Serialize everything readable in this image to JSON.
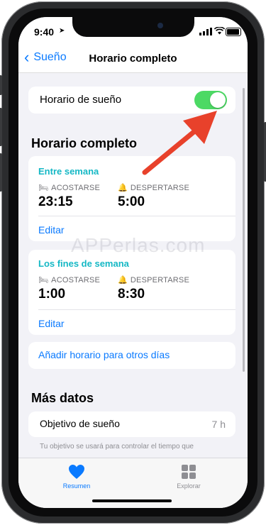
{
  "status": {
    "time": "9:40",
    "location_glyph": "➤"
  },
  "nav": {
    "back_label": "Sueño",
    "title": "Horario completo"
  },
  "toggle_row": {
    "label": "Horario de sueño",
    "enabled": true
  },
  "section_title": "Horario completo",
  "weekdays": {
    "title": "Entre semana",
    "bed_label": "ACOSTARSE",
    "wake_label": "DESPERTARSE",
    "bed_time": "23:15",
    "wake_time": "5:00",
    "edit": "Editar"
  },
  "weekend": {
    "title": "Los fines de semana",
    "bed_label": "ACOSTARSE",
    "wake_label": "DESPERTARSE",
    "bed_time": "1:00",
    "wake_time": "8:30",
    "edit": "Editar"
  },
  "add_other_days": "Añadir horario para otros días",
  "more_data": {
    "title": "Más datos",
    "goal_label": "Objetivo de sueño",
    "goal_value": "7 h",
    "footnote": "Tu objetivo se usará para controlar el tiempo que"
  },
  "tabs": [
    {
      "label": "Resumen",
      "icon": "heart-icon",
      "active": true
    },
    {
      "label": "Explorar",
      "icon": "grid-icon",
      "active": false
    }
  ],
  "watermark": "APPerlas.com",
  "colors": {
    "accent": "#0a7aff",
    "teal": "#15b8c5",
    "toggle_on": "#4cd964",
    "arrow": "#e8412b"
  }
}
